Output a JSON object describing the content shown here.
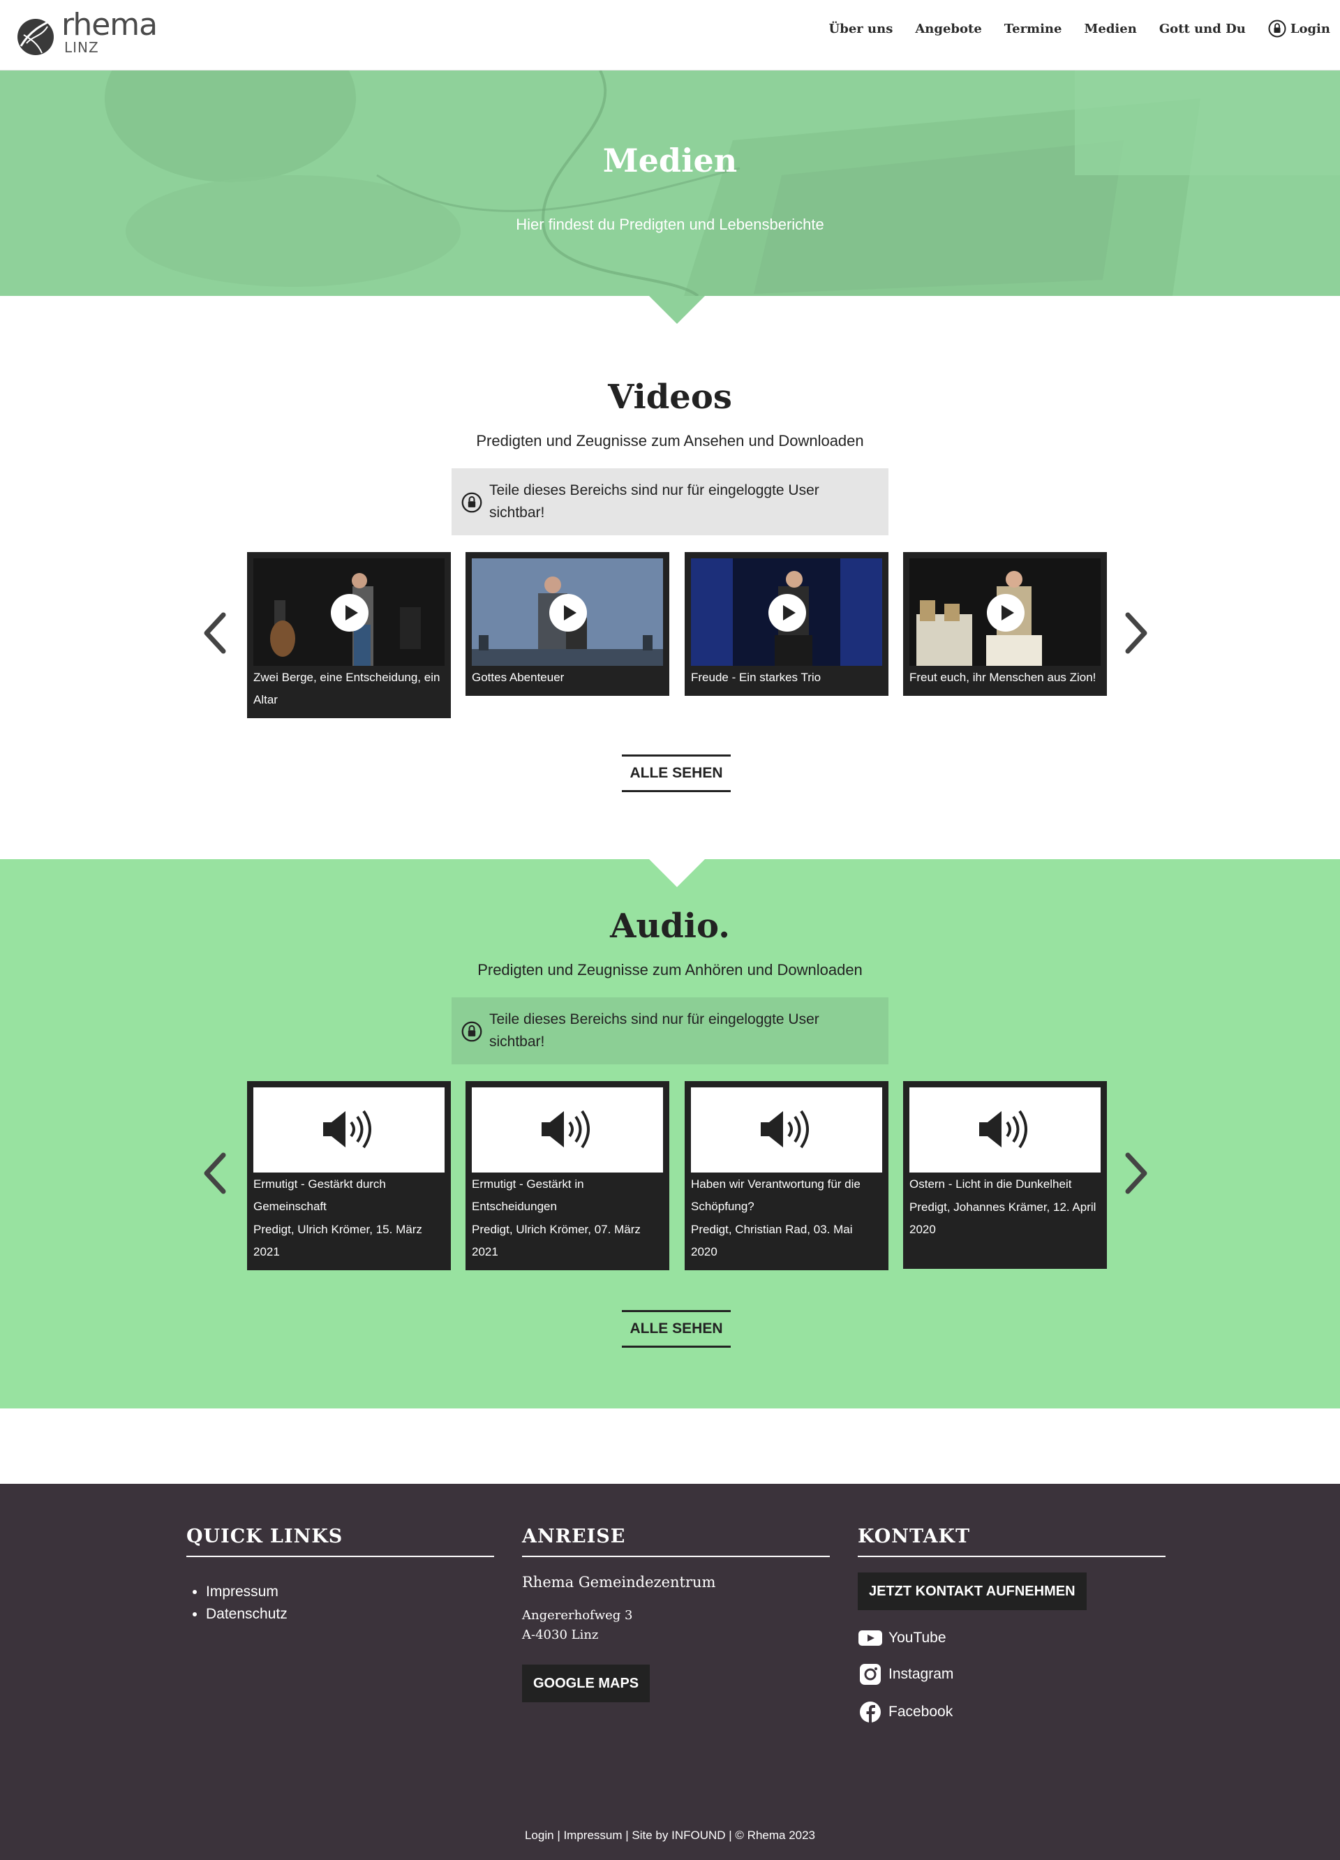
{
  "header": {
    "logo_word": "rhema",
    "logo_sub": "LINZ",
    "nav": [
      "Über uns",
      "Angebote",
      "Termine",
      "Medien",
      "Gott und Du"
    ],
    "login": "Login"
  },
  "hero": {
    "title": "Medien",
    "subtitle": "Hier findest du Predigten und Lebensberichte"
  },
  "videos": {
    "title": "Videos",
    "subtitle": "Predigten und Zeugnisse zum Ansehen und Downloaden",
    "notice": "Teile dieses Bereichs sind nur für eingeloggte User sichtbar!",
    "items": [
      {
        "title": "Zwei Berge, eine Entscheidung, ein Altar"
      },
      {
        "title": "Gottes Abenteuer"
      },
      {
        "title": "Freude - Ein starkes Trio"
      },
      {
        "title": "Freut euch, ihr Menschen aus Zion!"
      }
    ],
    "see_all": "ALLE SEHEN"
  },
  "audio": {
    "title": "Audio.",
    "subtitle": "Predigten und Zeugnisse zum Anhören und Downloaden",
    "notice": "Teile dieses Bereichs sind nur für eingeloggte User sichtbar!",
    "items": [
      {
        "title": "Ermutigt - Gestärkt durch Gemeinschaft",
        "meta": "Predigt, Ulrich Krömer, 15. März 2021"
      },
      {
        "title": "Ermutigt - Gestärkt in Entscheidungen",
        "meta": "Predigt, Ulrich Krömer, 07. März 2021"
      },
      {
        "title": "Haben wir Verantwortung für die Schöpfung?",
        "meta": "Predigt, Christian Rad, 03. Mai 2020"
      },
      {
        "title": "Ostern - Licht in die Dunkelheit",
        "meta": "Predigt, Johannes Krämer, 12. April 2020"
      }
    ],
    "see_all": "ALLE SEHEN"
  },
  "footer": {
    "quick_links_title": "QUICK LINKS",
    "quick_links": [
      "Impressum",
      "Datenschutz"
    ],
    "anreise_title": "ANREISE",
    "place_name": "Rhema Gemeindezentrum",
    "street": "Angererhofweg 3",
    "city": "A-4030 Linz",
    "maps_button": "GOOGLE MAPS",
    "kontakt_title": "KONTAKT",
    "contact_button": "JETZT KONTAKT AUFNEHMEN",
    "social": [
      "YouTube",
      "Instagram",
      "Facebook"
    ],
    "bottom": {
      "login": "Login",
      "impressum": "Impressum",
      "site_by": "Site by INFOUND",
      "copyright": "© Rhema 2023"
    }
  },
  "colors": {
    "hero_green": "#8fd19a",
    "audio_green": "#98e2a0",
    "footer_bg": "#3b333b",
    "dark": "#222222"
  }
}
